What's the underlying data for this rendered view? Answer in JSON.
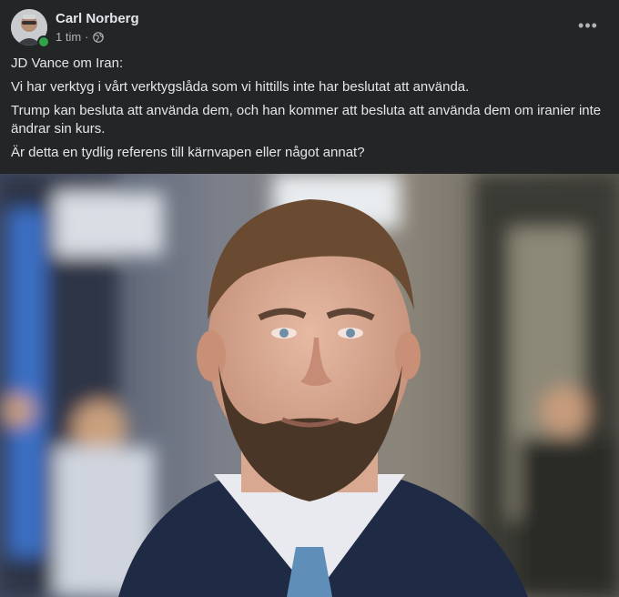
{
  "post": {
    "author": "Carl Norberg",
    "time": "1 tim",
    "separator": "·",
    "privacy_icon": "globe-icon",
    "more_icon": "more-horizontal-icon",
    "more_label": "•••",
    "paragraphs": [
      "JD Vance om Iran:",
      "Vi har verktyg i vårt verktygslåda som vi hittills inte har beslutat att använda.",
      "Trump kan besluta att använda dem, och han kommer att besluta att använda dem om iranier inte ändrar sin kurs.",
      "Är detta en tydlig referens till kärnvapen eller något annat?"
    ],
    "online_status_color": "#31a24c"
  },
  "colors": {
    "background": "#242526",
    "text_primary": "#e4e6eb",
    "text_secondary": "#b0b3b8"
  }
}
